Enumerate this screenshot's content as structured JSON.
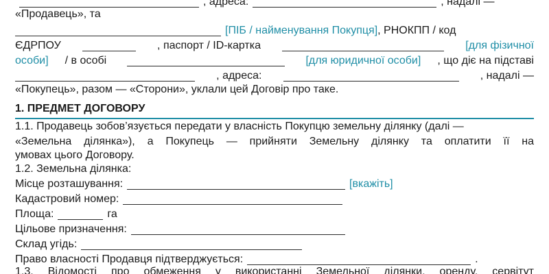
{
  "preamble": {
    "l1_address": ", адреса:",
    "l1_hereinafter": ", надалі —",
    "l2_seller_ref": "«Продавець», та",
    "l3_hint_name": "[ПІБ / найменування Покупця]",
    "l3_rnokpp": ", РНОКПП / код",
    "l4_edrpou": "ЄДРПОУ",
    "l4_passport": ", паспорт / ID-картка",
    "l4_hint_individual": "[для фізичної",
    "l5_hint_individual_end": "особи]",
    "l5_in_person": "/ в особі",
    "l5_hint_legal": "[для юридичної особи]",
    "l5_acting": ", що діє на підставі",
    "l6_address": ", адреса:",
    "l6_hereinafter": ", надалі —",
    "l7_text": "«Покупець», разом — «Сторони», уклали цей Договір про таке."
  },
  "section1": {
    "heading": "1. ПРЕДМЕТ ДОГОВОРУ",
    "p11_line1": "1.1. Продавець зобов’язується передати у власність Покупцю земельну ділянку (далі —",
    "p11_line2": "«Земельна ділянка»), а Покупець — прийняти Земельну ділянку та оплатити її на",
    "p11_line3": "умовах цього Договору.",
    "p12": "1.2. Земельна ділянка:",
    "location_label": "Місце розташування:",
    "location_hint": "[вкажіть]",
    "cadastral_label": "Кадастровий номер:",
    "area_label": "Площа:",
    "area_unit": "га",
    "purpose_label": "Цільове призначення:",
    "land_comp_label": "Склад угідь:",
    "ownership_label": "Право власності Продавця підтверджується:",
    "ownership_end": ".",
    "p13_partial": "1.3. Відомості про обмеження у використанні Земельної ділянки, оренду, сервітут"
  }
}
